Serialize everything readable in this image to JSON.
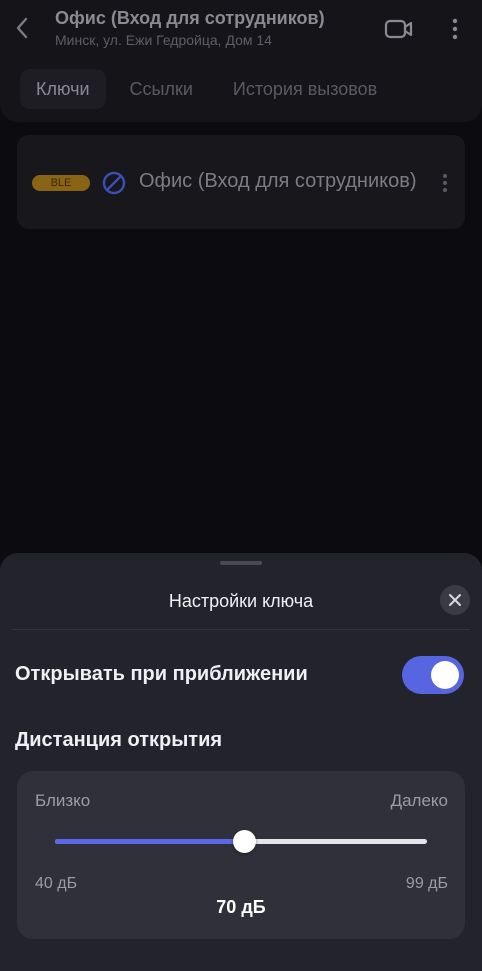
{
  "header": {
    "title": "Офис (Вход для сотрудников)",
    "subtitle": "Минск, ул. Ежи Гедройца, Дом 14"
  },
  "tabs": [
    {
      "label": "Ключи",
      "active": true
    },
    {
      "label": "Ссылки",
      "active": false
    },
    {
      "label": "История вызовов",
      "active": false
    }
  ],
  "key_card": {
    "badge": "BLE",
    "name": "Офис (Вход для сотрудников)"
  },
  "sheet": {
    "title": "Настройки ключа",
    "proximity_label": "Открывать при приближении",
    "proximity_enabled": true,
    "distance_label": "Дистанция открытия",
    "slider": {
      "near_label": "Близко",
      "far_label": "Далеко",
      "min_label": "40 дБ",
      "max_label": "99 дБ",
      "min": 40,
      "max": 99,
      "value": 70,
      "value_label": "70 дБ"
    }
  },
  "colors": {
    "accent": "#5865e0",
    "badge": "#8a6415",
    "block_icon": "#3c4fb8"
  },
  "icons": [
    "chevron-left-icon",
    "video-camera-icon",
    "more-vertical-icon",
    "block-icon",
    "close-icon"
  ]
}
